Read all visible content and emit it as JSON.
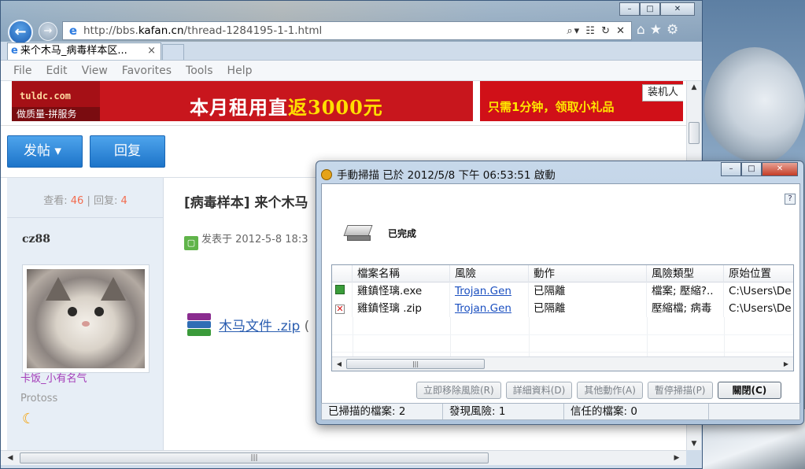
{
  "browser": {
    "url_prefix": "http://bbs.",
    "url_domain": "kafan.cn",
    "url_path": "/thread-1284195-1-1.html",
    "tab_title": "来个木马_病毒样本区...",
    "tab_close": "×",
    "menu": [
      "File",
      "Edit",
      "View",
      "Favorites",
      "Tools",
      "Help"
    ],
    "nav_back": "←",
    "nav_forward": "→",
    "addr_tools": "⌕▾ ☷ ↻ ✕",
    "right_icons": [
      "⌂",
      "★",
      "⚙"
    ],
    "win_controls": [
      "–",
      "□",
      "✕"
    ]
  },
  "ads": {
    "ad1_domain": "tuldc.com",
    "ad1_tagline": "做质量-拼服务",
    "ad1_slogan_pre": "本月租用直",
    "ad1_slogan_highlight": "返3000元",
    "ad2_slogan": "只需1分钟，领取小礼品",
    "ad2_tag": "装机人"
  },
  "thread": {
    "post_button": "发帖",
    "post_arrow": "▾",
    "reply_button": "回复",
    "views_label": "查看:",
    "views": "46",
    "separator": "|",
    "replies_label": "回复:",
    "replies": "4",
    "username": "cz88",
    "user_group": "卡饭_小有名气",
    "user_title": "Protoss",
    "title": "[病毒样本] 来个木马",
    "posted_at": "发表于 2012-5-8 18:3",
    "attachment_name": "木马文件 .zip",
    "attachment_suffix": "("
  },
  "dialog": {
    "title": "手動掃描 已於 2012/5/8 下午 06:53:51 啟動",
    "controls": [
      "–",
      "□",
      "✕"
    ],
    "help": "?",
    "status": "已完成",
    "columns": [
      "",
      "檔案名稱",
      "風險",
      "動作",
      "風險類型",
      "原始位置"
    ],
    "rows": [
      {
        "icon": "ok",
        "name": "雞鎮怪璃.exe",
        "risk": "Trojan.Gen",
        "action": "已隔離",
        "type": "檔案; 壓縮?..",
        "location": "C:\\Users\\De"
      },
      {
        "icon": "bad",
        "name": "雞鎮怪璃 .zip",
        "risk": "Trojan.Gen",
        "action": "已隔離",
        "type": "壓縮檔; 病毒",
        "location": "C:\\Users\\De"
      }
    ],
    "buttons": {
      "remove": "立即移除風險(R)",
      "details": "詳細資料(D)",
      "other": "其他動作(A)",
      "pause": "暫停掃描(P)",
      "close": "關閉(C)"
    },
    "statusbar": {
      "scanned": "已掃描的檔案: 2",
      "risks": "發現風險: 1",
      "trusted": "信任的檔案: 0"
    }
  }
}
